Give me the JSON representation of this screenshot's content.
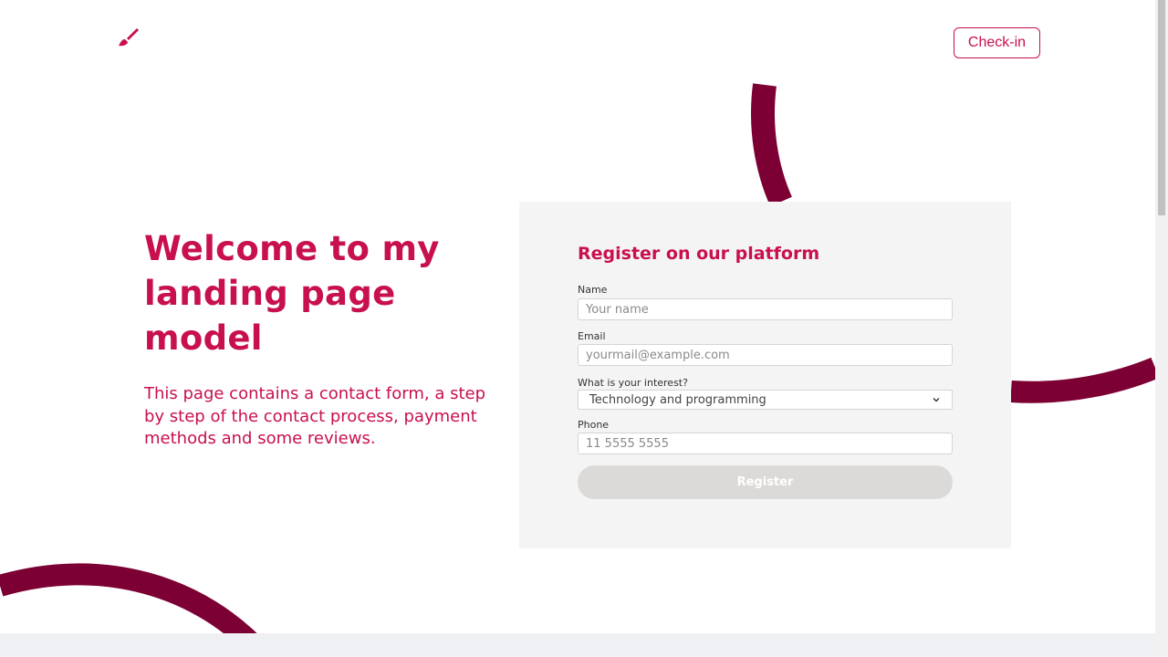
{
  "header": {
    "logo_icon": "paintbrush-icon",
    "checkin_label": "Check-in"
  },
  "hero": {
    "title": "Welcome to my landing page model",
    "description": "This page contains a contact form, a step by step of the contact process, payment methods and some reviews."
  },
  "form": {
    "title": "Register on our platform",
    "name": {
      "label": "Name",
      "placeholder": "Your name",
      "value": ""
    },
    "email": {
      "label": "Email",
      "placeholder": "yourmail@example.com",
      "value": ""
    },
    "interest": {
      "label": "What is your interest?",
      "selected": "Technology and programming"
    },
    "phone": {
      "label": "Phone",
      "placeholder": "11 5555 5555",
      "value": ""
    },
    "submit_label": "Register"
  },
  "colors": {
    "brand": "#c8104f",
    "decor_arc": "#7c0033",
    "card_bg": "#f4f4f4",
    "button_disabled": "#dcdad8"
  }
}
